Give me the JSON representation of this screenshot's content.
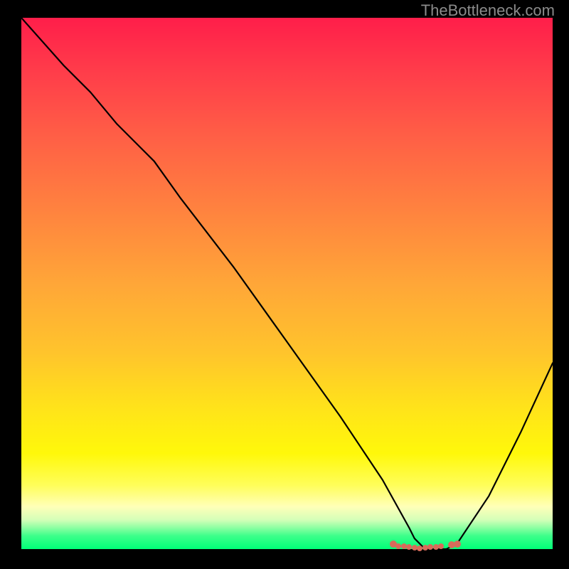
{
  "watermark": "TheBottleneck.com",
  "chart_data": {
    "type": "line",
    "title": "",
    "xlabel": "",
    "ylabel": "",
    "ylim": [
      0,
      100
    ],
    "xlim": [
      0,
      100
    ],
    "series": [
      {
        "name": "bottleneck-curve",
        "x": [
          0,
          8,
          13,
          18,
          23,
          25,
          30,
          40,
          50,
          60,
          68,
          73,
          74,
          76,
          78,
          80,
          82,
          88,
          94,
          100
        ],
        "values": [
          100,
          91,
          86,
          80,
          75,
          73,
          66,
          53,
          39,
          25,
          13,
          4,
          2,
          0,
          0,
          0,
          1,
          10,
          22,
          35
        ]
      }
    ],
    "markers": [
      {
        "x": 70,
        "y": 1
      },
      {
        "x": 71,
        "y": 0.6
      },
      {
        "x": 72,
        "y": 0.5
      },
      {
        "x": 73,
        "y": 0.4
      },
      {
        "x": 74,
        "y": 0.3
      },
      {
        "x": 75,
        "y": 0.2
      },
      {
        "x": 76,
        "y": 0.3
      },
      {
        "x": 77,
        "y": 0.4
      },
      {
        "x": 78,
        "y": 0.4
      },
      {
        "x": 79,
        "y": 0.5
      },
      {
        "x": 81,
        "y": 0.8
      },
      {
        "x": 82,
        "y": 1.0
      }
    ],
    "marker_color": "#d86b5a"
  }
}
